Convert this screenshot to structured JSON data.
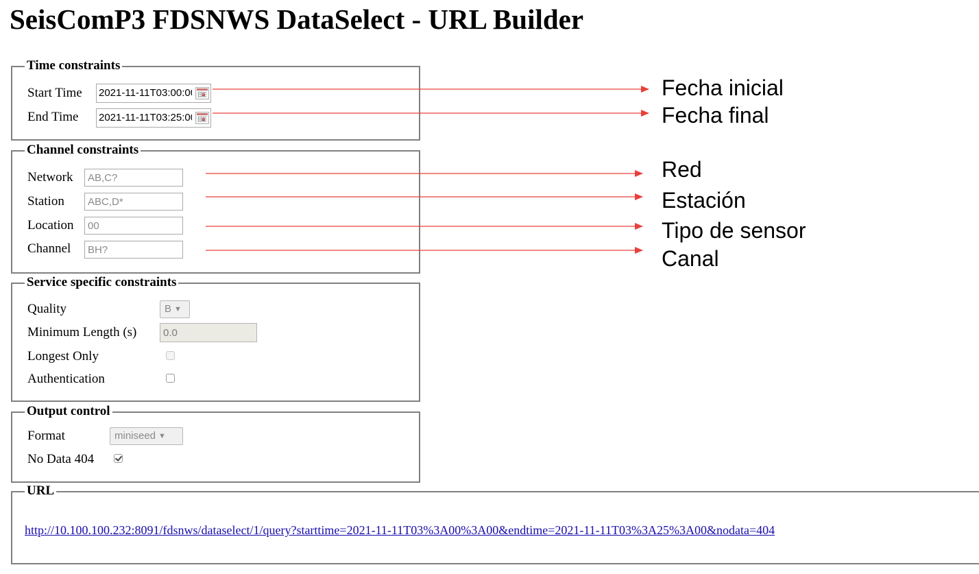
{
  "title": "SeisComP3 FDSNWS DataSelect - URL Builder",
  "time_constraints": {
    "legend": "Time constraints",
    "start_label": "Start Time",
    "start_value": "2021-11-11T03:00:00",
    "end_label": "End Time",
    "end_value": "2021-11-11T03:25:00"
  },
  "channel_constraints": {
    "legend": "Channel constraints",
    "network_label": "Network",
    "network_placeholder": "AB,C?",
    "station_label": "Station",
    "station_placeholder": "ABC,D*",
    "location_label": "Location",
    "location_placeholder": "00",
    "channel_label": "Channel",
    "channel_placeholder": "BH?"
  },
  "service_constraints": {
    "legend": "Service specific constraints",
    "quality_label": "Quality",
    "quality_value": "B",
    "minlength_label": "Minimum Length (s)",
    "minlength_value": "0.0",
    "longest_label": "Longest Only",
    "longest_checked": false,
    "auth_label": "Authentication",
    "auth_checked": false
  },
  "output_control": {
    "legend": "Output control",
    "format_label": "Format",
    "format_value": "miniseed",
    "nodata_label": "No Data 404",
    "nodata_checked": true
  },
  "url_section": {
    "legend": "URL",
    "link": "http://10.100.100.232:8091/fdsnws/dataselect/1/query?starttime=2021-11-11T03%3A00%3A00&endtime=2021-11-11T03%3A25%3A00&nodata=404"
  },
  "annotations": {
    "start": "Fecha inicial",
    "end": "Fecha final",
    "network": "Red",
    "station": "Estación",
    "location": "Tipo de sensor",
    "channel": "Canal",
    "arrow_color": "#e8403a"
  },
  "icons": {
    "calendar": "calendar-icon",
    "dropdown": "chevron-down-icon"
  }
}
